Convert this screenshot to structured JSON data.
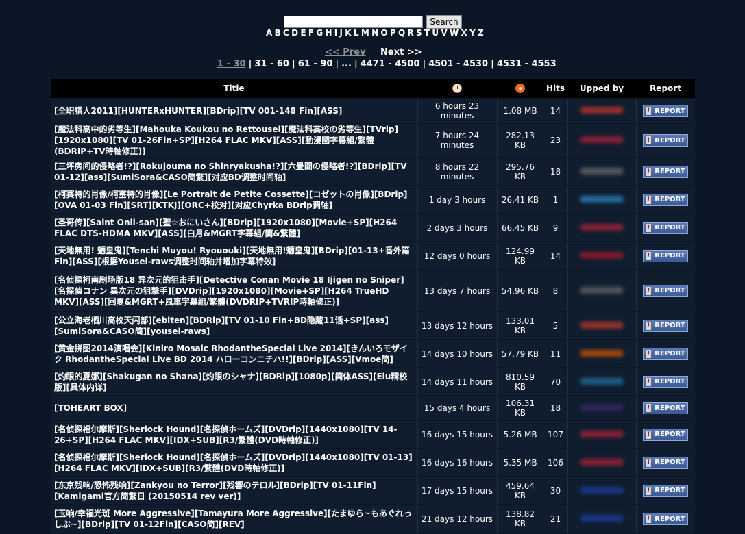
{
  "search": {
    "button_label": "Search",
    "placeholder": ""
  },
  "alphabet": [
    "A",
    "B",
    "C",
    "D",
    "E",
    "F",
    "G",
    "H",
    "I",
    "J",
    "K",
    "L",
    "M",
    "N",
    "O",
    "P",
    "Q",
    "R",
    "S",
    "T",
    "U",
    "V",
    "W",
    "X",
    "Y",
    "Z"
  ],
  "pagination": {
    "prev_label": "<< Prev",
    "next_label": "Next >>",
    "pages": [
      "1 - 30",
      "31 - 60",
      "61 - 90",
      "...",
      "4471 - 4500",
      "4501 - 4530",
      "4531 - 4553"
    ]
  },
  "table": {
    "headers": {
      "title": "Title",
      "hits": "Hits",
      "upped_by": "Upped by",
      "report": "Report"
    },
    "report_label": "REPORT",
    "rows": [
      {
        "title": "[全职猎人2011][HUNTERxHUNTER][BDrip][TV 001-148 Fin][ASS]",
        "time": "6 hours 23 minutes",
        "size": "1.08 MB",
        "hits": "14",
        "uploader_color": "#c0392b"
      },
      {
        "title": "[魔法科高中的劣等生][Mahouka Koukou no Rettousei][魔法科高校の劣等生][TVrip][1920x1080][TV 01-26Fin+SP][H264 FLAC MKV][ASS][動漫國字幕組/繁體(BDRIP+TV時軸修正)]",
        "time": "7 hours 24 minutes",
        "size": "282.13 KB",
        "hits": "23",
        "uploader_color": "#b0223a"
      },
      {
        "title": "[三坪房间的侵略者!?][Rokujouma no Shinryakusha!?][六畳間の侵略者!?][BDrip][TV 01-12][ass][SumiSora&CASO简繁][对应BD调整时间轴]",
        "time": "8 hours 22 minutes",
        "size": "295.76 KB",
        "hits": "18",
        "uploader_color": "#6a6a6a"
      },
      {
        "title": "[柯赛特的肖像/柯塞特的肖像][Le Portrait de Petite Cossette][コゼットの肖像][BDrip][OVA 01-03 Fin][SRT][KTKJ][ORC+校对][对应Chyrka BDrip调轴]",
        "time": "1 day 3 hours",
        "size": "26.41 KB",
        "hits": "1",
        "uploader_color": "#2e86c1"
      },
      {
        "title": "[圣哥传][Saint Onii-san][聖☆おにいさん][BDrip][1920x1080][Movie+SP][H264 FLAC DTS-HDMA MKV][ASS][白月&MGRT字幕組/簡&繁體]",
        "time": "2 days 3 hours",
        "size": "66.45 KB",
        "hits": "9",
        "uploader_color": "#b0223a"
      },
      {
        "title": "[天地無用! 魎皇鬼][Tenchi Muyou! Ryououki][天地無用!魎皇鬼][BDrip][01-13+番外篇Fin][ASS][根据Yousei-raws调整时间轴并增加字幕特效]",
        "time": "12 days 0 hours",
        "size": "124.99 KB",
        "hits": "14",
        "uploader_color": "#a8192a"
      },
      {
        "title": "[名侦探柯南剧场版18 异次元的狙击手][Detective Conan Movie 18 Ijigen no Sniper][名探偵コナン 異次元の狙撃手][DVDrip][1920x1080][Movie+SP][H264 TrueHD MKV][ASS][回夏&MGRT+風車字幕組/繁體(DVDRIP+TVRIP時軸修正)]",
        "time": "13 days 7 hours",
        "size": "54.96 KB",
        "hits": "8",
        "uploader_color": "#6a6a6a"
      },
      {
        "title": "[公立海老栖川高校天闪部][ebiten][BDRip][TV 01-10 Fin+BD隐藏11话+SP][ass][SumiSora&CASO简][yousei-raws]",
        "time": "13 days 12 hours",
        "size": "133.01 KB",
        "hits": "5",
        "uploader_color": "#c0392b"
      },
      {
        "title": "[黄金拼图2014演唱会][Kiniro Mosaic RhodantheSpecial Live 2014][きんいろモザイク RhodantheSpecial Live BD 2014 ハローコンニチハ!!][BDrip][ASS][Vmoe简]",
        "time": "14 days 10 hours",
        "size": "57.79 KB",
        "hits": "11",
        "uploader_color": "#d35400"
      },
      {
        "title": "[灼眼的夏娜][Shakugan no Shana][灼眼のシャナ][BDRip][1080p][简体ASS][Elu精校版][具体内详]",
        "time": "14 days 11 hours",
        "size": "810.59 KB",
        "hits": "70",
        "uploader_color": "#2471a3"
      },
      {
        "title": "[TOHEART BOX]",
        "time": "15 days 4 hours",
        "size": "106.31 KB",
        "hits": "18",
        "uploader_color": "#3b2a6a"
      },
      {
        "title": "[名侦探福尔摩斯][Sherlock Hound][名探偵ホームズ][DVDrip][1440x1080][TV 14-26+SP][H264 FLAC MKV][IDX+SUB][R3/繁體(DVD時軸修正)]",
        "time": "16 days 15 hours",
        "size": "5.26 MB",
        "hits": "107",
        "uploader_color": "#b0223a"
      },
      {
        "title": "[名侦探福尔摩斯][Sherlock Hound][名探偵ホームズ][DVDrip][1440x1080][TV 01-13][H264 FLAC MKV][IDX+SUB][R3/繁體(DVD時軸修正)]",
        "time": "16 days 16 hours",
        "size": "5.35 MB",
        "hits": "106",
        "uploader_color": "#b0223a"
      },
      {
        "title": "[东京残响/恐怖残响][Zankyou no Terror][残響のテロル][BDrip][TV 01-11Fin][Kamigami官方简繁日 (20150514 rev ver)]",
        "time": "17 days 15 hours",
        "size": "459.64 KB",
        "hits": "30",
        "uploader_color": "#1f3fa0"
      },
      {
        "title": "[玉响/幸福光斑 More Aggressive][Tamayura More Aggressive][たまゆら~もあぐれっしぶ~][BDrip][TV 01-12Fin][CASO简][REV]",
        "time": "21 days 12 hours",
        "size": "138.82 KB",
        "hits": "21",
        "uploader_color": "#1f3fa0"
      }
    ]
  }
}
